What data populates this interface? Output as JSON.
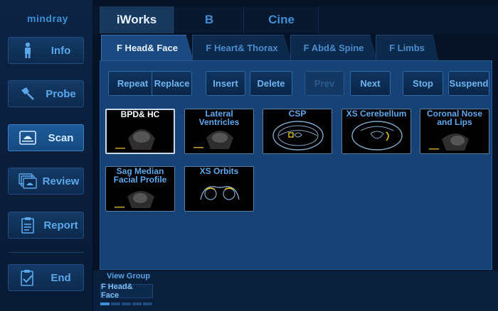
{
  "brand": "mindray",
  "sidebar": {
    "items": [
      {
        "label": "Info",
        "icon": "person-icon"
      },
      {
        "label": "Probe",
        "icon": "probe-icon"
      },
      {
        "label": "Scan",
        "icon": "scan-icon",
        "active": true
      },
      {
        "label": "Review",
        "icon": "review-icon"
      },
      {
        "label": "Report",
        "icon": "report-icon"
      },
      {
        "label": "End",
        "icon": "end-icon"
      }
    ]
  },
  "top_tabs": [
    {
      "label": "iWorks",
      "active": true
    },
    {
      "label": "B"
    },
    {
      "label": "Cine"
    }
  ],
  "sub_tabs": [
    {
      "label": "F Head& Face",
      "active": true
    },
    {
      "label": "F Heart& Thorax"
    },
    {
      "label": "F Abd& Spine"
    },
    {
      "label": "F Limbs"
    }
  ],
  "actions": [
    {
      "label": "Repeat"
    },
    {
      "label": "Replace"
    },
    {
      "label": "Insert"
    },
    {
      "label": "Delete"
    },
    {
      "label": "Prev",
      "disabled": true
    },
    {
      "label": "Next"
    },
    {
      "label": "Stop"
    },
    {
      "label": "Suspend"
    }
  ],
  "views": [
    {
      "label": "BPD& HC",
      "active": true
    },
    {
      "label": "Lateral Ventricles"
    },
    {
      "label": "CSP"
    },
    {
      "label": "XS Cerebellum"
    },
    {
      "label": "Coronal Nose and Lips"
    },
    {
      "label": "Sag Median Facial Profile"
    },
    {
      "label": "XS Orbits"
    }
  ],
  "view_group": {
    "title": "View Group",
    "current": "F Head& Face"
  },
  "colors": {
    "accent": "#3b8fd6",
    "panel": "#174276",
    "background": "#061326"
  }
}
